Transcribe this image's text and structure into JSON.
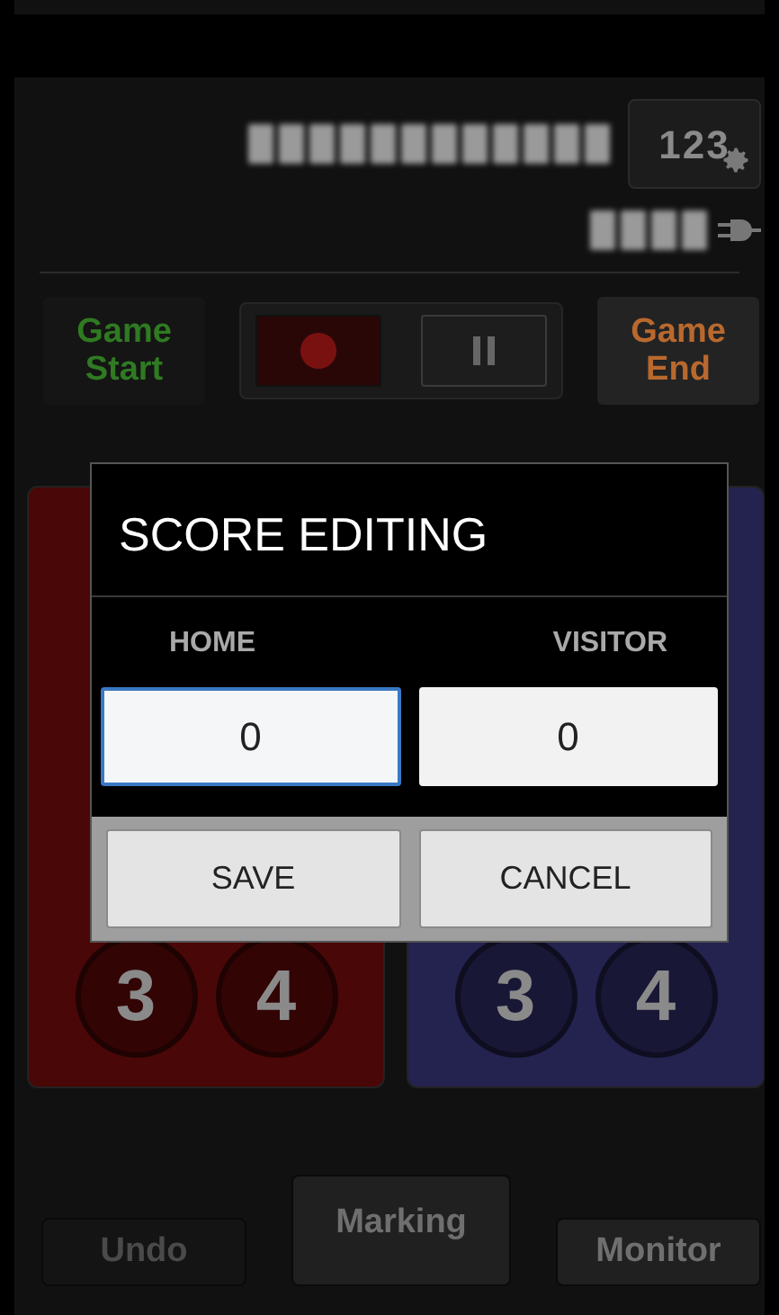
{
  "header": {
    "settings_icon_text": "123"
  },
  "controls": {
    "game_start": {
      "label": "Game\nStart",
      "disabled": true
    },
    "record": {
      "selected": true
    },
    "pause": {
      "selected": false
    },
    "game_end": {
      "label": "Game\nEnd",
      "disabled": false
    }
  },
  "panels": [
    {
      "color": "#4a0707",
      "buttons": [
        "3",
        "4"
      ]
    },
    {
      "color": "#24224e",
      "buttons": [
        "3",
        "4"
      ]
    }
  ],
  "bottom_buttons": [
    {
      "label": "Undo",
      "disabled": true,
      "kind": "small"
    },
    {
      "label": "Marking",
      "disabled": false,
      "kind": "large"
    },
    {
      "label": "Monitor",
      "disabled": false,
      "kind": "small"
    }
  ],
  "dialog": {
    "title": "SCORE EDITING",
    "fields": [
      {
        "label": "HOME",
        "value": "0",
        "focused": true
      },
      {
        "label": "VISITOR",
        "value": "0",
        "focused": false
      }
    ],
    "buttons": [
      "SAVE",
      "CANCEL"
    ]
  }
}
